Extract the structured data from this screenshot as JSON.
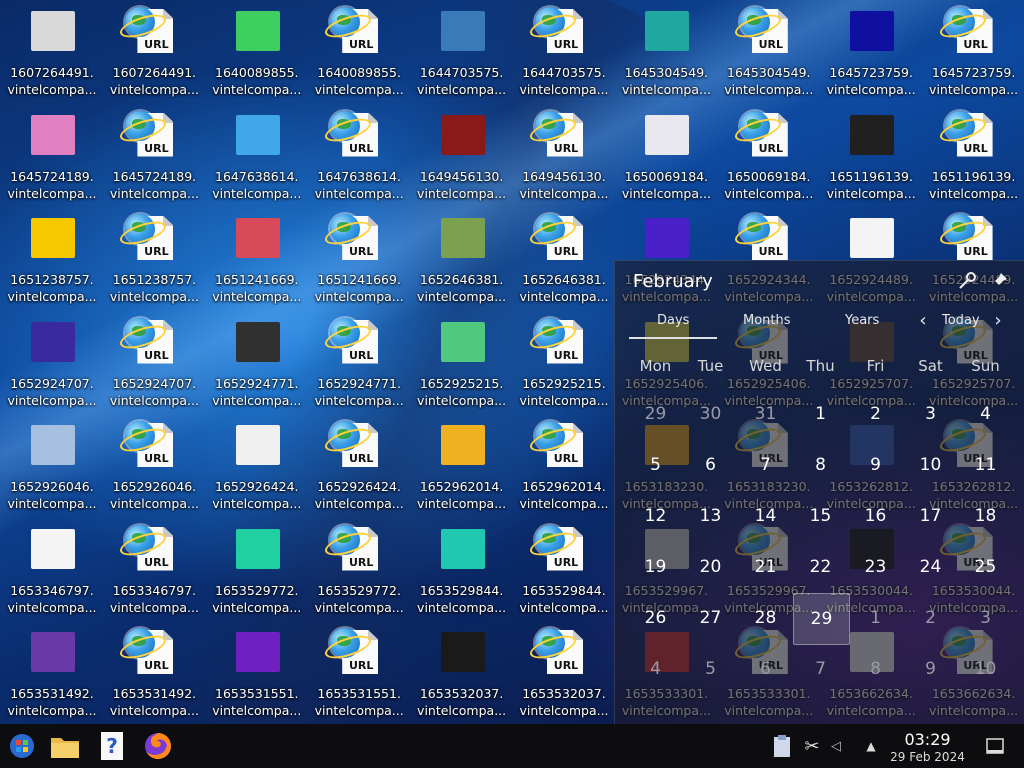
{
  "desktop": {
    "icons": [
      {
        "line1": "1607264491.",
        "line2": "vintelcompa...",
        "kind": "thumb",
        "color": "#d9d9d9"
      },
      {
        "line1": "1607264491.",
        "line2": "vintelcompa...",
        "kind": "url"
      },
      {
        "line1": "1640089855.",
        "line2": "vintelcompa...",
        "kind": "thumb",
        "color": "#3fcf60"
      },
      {
        "line1": "1640089855.",
        "line2": "vintelcompa...",
        "kind": "url"
      },
      {
        "line1": "1644703575.",
        "line2": "vintelcompa...",
        "kind": "thumb",
        "color": "#3a7ab8"
      },
      {
        "line1": "1644703575.",
        "line2": "vintelcompa...",
        "kind": "url"
      },
      {
        "line1": "1645304549.",
        "line2": "vintelcompa...",
        "kind": "thumb",
        "color": "#20a8a0"
      },
      {
        "line1": "1645304549.",
        "line2": "vintelcompa...",
        "kind": "url"
      },
      {
        "line1": "1645723759.",
        "line2": "vintelcompa...",
        "kind": "thumb",
        "color": "#1010a0"
      },
      {
        "line1": "1645723759.",
        "line2": "vintelcompa...",
        "kind": "url"
      },
      {
        "line1": "1645724189.",
        "line2": "vintelcompa...",
        "kind": "thumb",
        "color": "#e080c0"
      },
      {
        "line1": "1645724189.",
        "line2": "vintelcompa...",
        "kind": "url"
      },
      {
        "line1": "1647638614.",
        "line2": "vintelcompa...",
        "kind": "thumb",
        "color": "#40a8e8"
      },
      {
        "line1": "1647638614.",
        "line2": "vintelcompa...",
        "kind": "url"
      },
      {
        "line1": "1649456130.",
        "line2": "vintelcompa...",
        "kind": "thumb",
        "color": "#8a1a1a"
      },
      {
        "line1": "1649456130.",
        "line2": "vintelcompa...",
        "kind": "url"
      },
      {
        "line1": "1650069184.",
        "line2": "vintelcompa...",
        "kind": "thumb",
        "color": "#e8e8ee"
      },
      {
        "line1": "1650069184.",
        "line2": "vintelcompa...",
        "kind": "url"
      },
      {
        "line1": "1651196139.",
        "line2": "vintelcompa...",
        "kind": "thumb",
        "color": "#202020"
      },
      {
        "line1": "1651196139.",
        "line2": "vintelcompa...",
        "kind": "url"
      },
      {
        "line1": "1651238757.",
        "line2": "vintelcompa...",
        "kind": "thumb",
        "color": "#f5c800"
      },
      {
        "line1": "1651238757.",
        "line2": "vintelcompa...",
        "kind": "url"
      },
      {
        "line1": "1651241669.",
        "line2": "vintelcompa...",
        "kind": "thumb",
        "color": "#d84a5a"
      },
      {
        "line1": "1651241669.",
        "line2": "vintelcompa...",
        "kind": "url"
      },
      {
        "line1": "1652646381.",
        "line2": "vintelcompa...",
        "kind": "thumb",
        "color": "#7aa050"
      },
      {
        "line1": "1652646381.",
        "line2": "vintelcompa...",
        "kind": "url"
      },
      {
        "line1": "1652924344.",
        "line2": "vintelcompa...",
        "kind": "thumb",
        "color": "#4a20c8"
      },
      {
        "line1": "1652924344.",
        "line2": "vintelcompa...",
        "kind": "url"
      },
      {
        "line1": "1652924489.",
        "line2": "vintelcompa...",
        "kind": "thumb",
        "color": "#f4f4f4"
      },
      {
        "line1": "1652924489.",
        "line2": "vintelcompa...",
        "kind": "url"
      },
      {
        "line1": "1652924707.",
        "line2": "vintelcompa...",
        "kind": "thumb",
        "color": "#3a2aa0"
      },
      {
        "line1": "1652924707.",
        "line2": "vintelcompa...",
        "kind": "url"
      },
      {
        "line1": "1652924771.",
        "line2": "vintelcompa...",
        "kind": "thumb",
        "color": "#303030"
      },
      {
        "line1": "1652924771.",
        "line2": "vintelcompa...",
        "kind": "url"
      },
      {
        "line1": "1652925215.",
        "line2": "vintelcompa...",
        "kind": "thumb",
        "color": "#50c880"
      },
      {
        "line1": "1652925215.",
        "line2": "vintelcompa...",
        "kind": "url"
      },
      {
        "line1": "1652925406.",
        "line2": "vintelcompa...",
        "kind": "thumb",
        "color": "#d8d850"
      },
      {
        "line1": "1652925406.",
        "line2": "vintelcompa...",
        "kind": "url"
      },
      {
        "line1": "1652925707.",
        "line2": "vintelcompa...",
        "kind": "thumb",
        "color": "#605040"
      },
      {
        "line1": "1652925707.",
        "line2": "vintelcompa...",
        "kind": "url"
      },
      {
        "line1": "1652926046.",
        "line2": "vintelcompa...",
        "kind": "thumb",
        "color": "#a8c0e0"
      },
      {
        "line1": "1652926046.",
        "line2": "vintelcompa...",
        "kind": "url"
      },
      {
        "line1": "1652926424.",
        "line2": "vintelcompa...",
        "kind": "thumb",
        "color": "#f0f0f0"
      },
      {
        "line1": "1652926424.",
        "line2": "vintelcompa...",
        "kind": "url"
      },
      {
        "line1": "1652962014.",
        "line2": "vintelcompa...",
        "kind": "thumb",
        "color": "#f0b020"
      },
      {
        "line1": "1652962014.",
        "line2": "vintelcompa...",
        "kind": "url"
      },
      {
        "line1": "1653183230.",
        "line2": "vintelcompa...",
        "kind": "thumb",
        "color": "#e0a020"
      },
      {
        "line1": "1653183230.",
        "line2": "vintelcompa...",
        "kind": "url"
      },
      {
        "line1": "1653262812.",
        "line2": "vintelcompa...",
        "kind": "thumb",
        "color": "#3060c0"
      },
      {
        "line1": "1653262812.",
        "line2": "vintelcompa...",
        "kind": "url"
      },
      {
        "line1": "1653346797.",
        "line2": "vintelcompa...",
        "kind": "thumb",
        "color": "#f4f4f4"
      },
      {
        "line1": "1653346797.",
        "line2": "vintelcompa...",
        "kind": "url"
      },
      {
        "line1": "1653529772.",
        "line2": "vintelcompa...",
        "kind": "thumb",
        "color": "#20d0a0"
      },
      {
        "line1": "1653529772.",
        "line2": "vintelcompa...",
        "kind": "url"
      },
      {
        "line1": "1653529844.",
        "line2": "vintelcompa...",
        "kind": "thumb",
        "color": "#20c8b0"
      },
      {
        "line1": "1653529844.",
        "line2": "vintelcompa...",
        "kind": "url"
      },
      {
        "line1": "1653529967.",
        "line2": "vintelcompa...",
        "kind": "thumb",
        "color": "#c8c8c8"
      },
      {
        "line1": "1653529967.",
        "line2": "vintelcompa...",
        "kind": "url"
      },
      {
        "line1": "1653530044.",
        "line2": "vintelcompa...",
        "kind": "thumb",
        "color": "#181818"
      },
      {
        "line1": "1653530044.",
        "line2": "vintelcompa...",
        "kind": "url"
      },
      {
        "line1": "1653531492.",
        "line2": "vintelcompa...",
        "kind": "thumb",
        "color": "#6a3aa8"
      },
      {
        "line1": "1653531492.",
        "line2": "vintelcompa...",
        "kind": "url"
      },
      {
        "line1": "1653531551.",
        "line2": "vintelcompa...",
        "kind": "thumb",
        "color": "#7020c0"
      },
      {
        "line1": "1653531551.",
        "line2": "vintelcompa...",
        "kind": "url"
      },
      {
        "line1": "1653532037.",
        "line2": "vintelcompa...",
        "kind": "thumb",
        "color": "#1a1a1a"
      },
      {
        "line1": "1653532037.",
        "line2": "vintelcompa...",
        "kind": "url"
      },
      {
        "line1": "1653533301.",
        "line2": "vintelcompa...",
        "kind": "thumb",
        "color": "#d03030"
      },
      {
        "line1": "1653533301.",
        "line2": "vintelcompa...",
        "kind": "url"
      },
      {
        "line1": "1653662634.",
        "line2": "vintelcompa...",
        "kind": "thumb",
        "color": "#e8e8e8"
      },
      {
        "line1": "1653662634.",
        "line2": "vintelcompa...",
        "kind": "url"
      }
    ],
    "url_label": "URL"
  },
  "calendar": {
    "month": "February",
    "tabs": [
      "Days",
      "Months",
      "Years"
    ],
    "today_label": "Today",
    "weekdays": [
      "Mon",
      "Tue",
      "Wed",
      "Thu",
      "Fri",
      "Sat",
      "Sun"
    ],
    "days": [
      {
        "n": "29",
        "dim": true
      },
      {
        "n": "30",
        "dim": true
      },
      {
        "n": "31",
        "dim": true
      },
      {
        "n": "1"
      },
      {
        "n": "2"
      },
      {
        "n": "3"
      },
      {
        "n": "4"
      },
      {
        "n": "5"
      },
      {
        "n": "6"
      },
      {
        "n": "7"
      },
      {
        "n": "8"
      },
      {
        "n": "9"
      },
      {
        "n": "10"
      },
      {
        "n": "11"
      },
      {
        "n": "12"
      },
      {
        "n": "13"
      },
      {
        "n": "14"
      },
      {
        "n": "15"
      },
      {
        "n": "16"
      },
      {
        "n": "17"
      },
      {
        "n": "18"
      },
      {
        "n": "19"
      },
      {
        "n": "20"
      },
      {
        "n": "21"
      },
      {
        "n": "22"
      },
      {
        "n": "23"
      },
      {
        "n": "24"
      },
      {
        "n": "25"
      },
      {
        "n": "26"
      },
      {
        "n": "27"
      },
      {
        "n": "28"
      },
      {
        "n": "29",
        "today": true
      },
      {
        "n": "1",
        "dim": true
      },
      {
        "n": "2",
        "dim": true
      },
      {
        "n": "3",
        "dim": true
      },
      {
        "n": "4",
        "dim": true
      },
      {
        "n": "5",
        "dim": true
      },
      {
        "n": "6",
        "dim": true
      },
      {
        "n": "7",
        "dim": true
      },
      {
        "n": "8",
        "dim": true
      },
      {
        "n": "9",
        "dim": true
      },
      {
        "n": "10",
        "dim": true
      }
    ]
  },
  "taskbar": {
    "clock_time": "03:29",
    "clock_date": "29 Feb 2024",
    "apps": [
      "start-menu",
      "file-manager",
      "help",
      "firefox"
    ]
  }
}
